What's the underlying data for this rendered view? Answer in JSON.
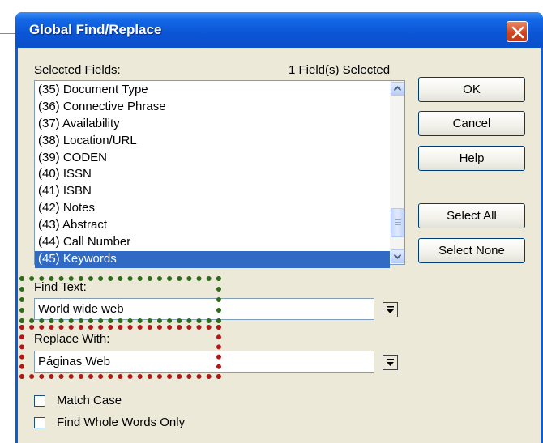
{
  "dialog": {
    "title": "Global Find/Replace",
    "selected_fields_label": "Selected Fields:",
    "selected_count": "1 Field(s) Selected",
    "fields": [
      "(35) Document Type",
      "(36) Connective Phrase",
      "(37) Availability",
      "(38) Location/URL",
      "(39) CODEN",
      "(40) ISSN",
      "(41) ISBN",
      "(42) Notes",
      "(43) Abstract",
      "(44) Call Number",
      "(45) Keywords"
    ],
    "selected_field": "(45) Keywords",
    "find_label": "Find Text:",
    "find_value": "World wide web",
    "replace_label": "Replace With:",
    "replace_value": "Páginas Web",
    "match_case_label": "Match Case",
    "match_case_checked": false,
    "whole_words_label": "Find Whole Words Only",
    "whole_words_checked": false,
    "buttons": {
      "ok": "OK",
      "cancel": "Cancel",
      "help": "Help",
      "select_all": "Select All",
      "select_none": "Select None"
    }
  },
  "icons": {
    "close": "close-icon",
    "scroll_up": "chevron-up-icon",
    "scroll_down": "chevron-down-icon",
    "dropdown": "dropdown-arrow-icon"
  },
  "colors": {
    "titlebar": "#0a55d6",
    "close_button": "#d2461f",
    "selection": "#316ac5",
    "find_highlight": "#2e6b1a",
    "replace_highlight": "#b01818",
    "dialog_background": "#ece9d8"
  }
}
